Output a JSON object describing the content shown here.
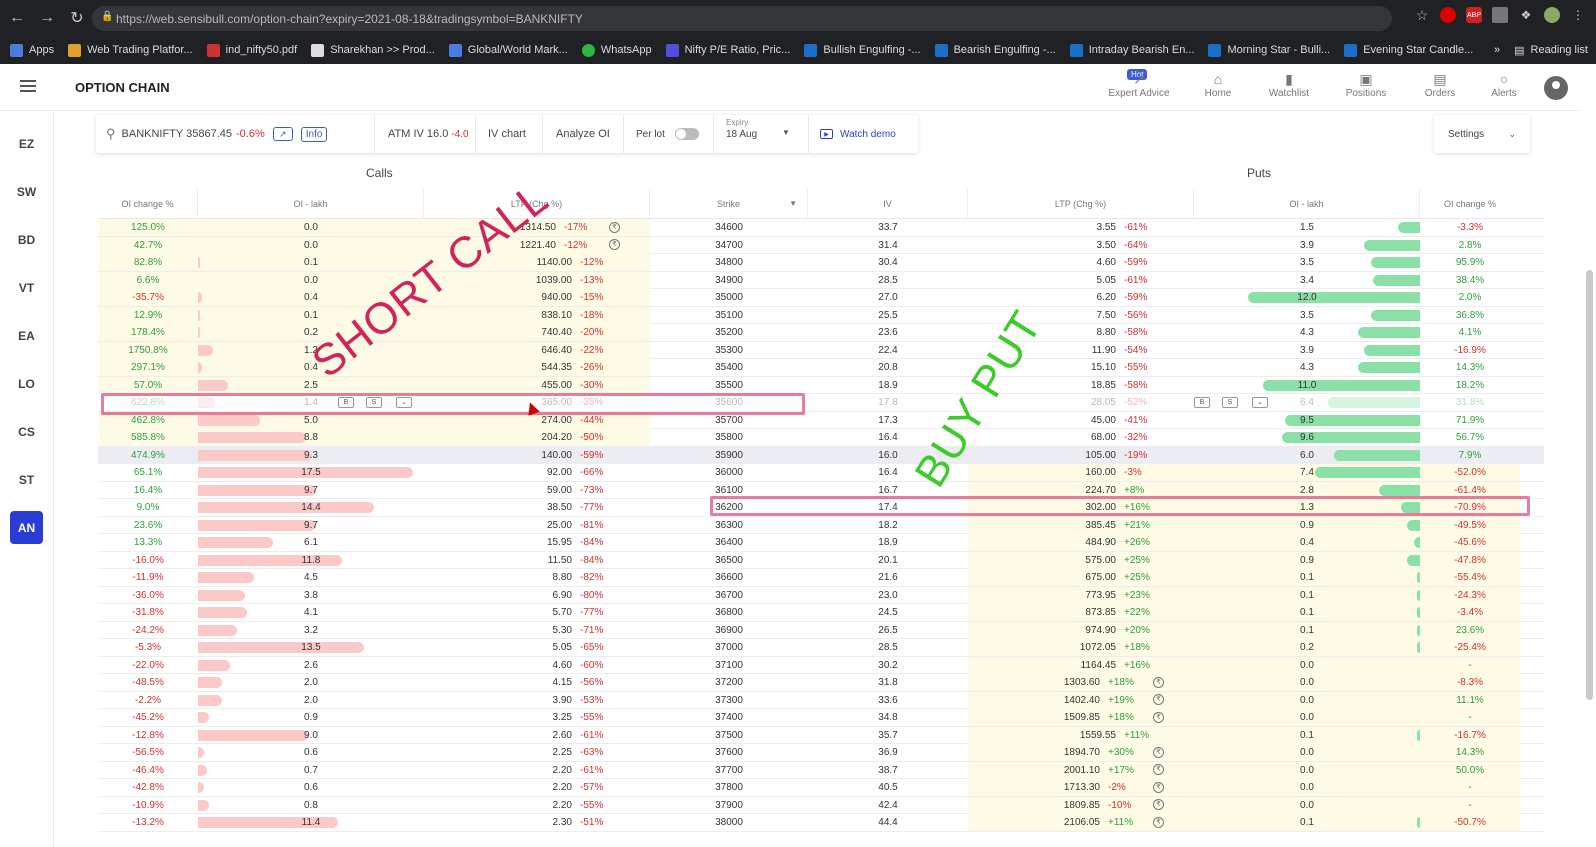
{
  "browser": {
    "url": "https://web.sensibull.com/option-chain?expiry=2021-08-18&tradingsymbol=BANKNIFTY",
    "bookmarks": [
      "Apps",
      "Web Trading Platfor...",
      "ind_nifty50.pdf",
      "Sharekhan >> Prod...",
      "Global/World Mark...",
      "WhatsApp",
      "Nifty P/E Ratio, Pric...",
      "Bullish Engulfing -...",
      "Bearish Engulfing -...",
      "Intraday Bearish En...",
      "Morning Star - Bulli...",
      "Evening Star Candle..."
    ],
    "reading_list": "Reading list",
    "ext_labels": [
      "ABP"
    ]
  },
  "header": {
    "title": "OPTION CHAIN",
    "hot_badge": "Hot",
    "nav": [
      "Expert Advice",
      "Home",
      "Watchlist",
      "Positions",
      "Orders",
      "Alerts"
    ]
  },
  "sidebar": [
    "EZ",
    "SW",
    "BD",
    "VT",
    "EA",
    "LO",
    "CS",
    "ST",
    "AN"
  ],
  "toolbar": {
    "symbol": "BANKNIFTY 35867.45",
    "symbol_change": "-0.6%",
    "info": "Info",
    "atm_iv": "ATM IV 16.0",
    "atm_iv_change": "-4.0",
    "iv_chart": "IV chart",
    "analyze_oi": "Analyze OI",
    "per_lot": "Per lot",
    "expiry_label": "Expiry",
    "expiry_value": "18 Aug",
    "watch_demo": "Watch demo",
    "settings": "Settings"
  },
  "sections": {
    "calls": "Calls",
    "puts": "Puts"
  },
  "columns": [
    "OI change %",
    "OI - lakh",
    "LTP (Chg %)",
    "Strike",
    "IV",
    "LTP (Chg %)",
    "OI - lakh",
    "OI change %"
  ],
  "row_buttons": {
    "buy": "B",
    "sell": "S"
  },
  "annotations": {
    "short_call": "SHORT CALL",
    "buy_put": "BUY PUT"
  },
  "colors": {
    "positive": "#2e9e3d",
    "negative": "#d32f2f",
    "accent": "#2a3cd6",
    "highlight": "#e0507a"
  },
  "rows": [
    {
      "coc": "125.0%",
      "coi": "0.0",
      "cl": "1314.50",
      "clc": "-17%",
      "strike": "34600",
      "iv": "33.7",
      "pl": "3.55",
      "plc": "-61%",
      "poi": "1.5",
      "poc": "-3.3%",
      "cbar": 0,
      "pbar": 0.1,
      "cc": 1,
      "pc": 0
    },
    {
      "coc": "42.7%",
      "coi": "0.0",
      "cl": "1221.40",
      "clc": "-12%",
      "strike": "34700",
      "iv": "31.4",
      "pl": "3.50",
      "plc": "-64%",
      "poi": "3.9",
      "poc": "2.8%",
      "cbar": 0,
      "pbar": 0.26,
      "cc": 1,
      "pc": 0
    },
    {
      "coc": "82.8%",
      "coi": "0.1",
      "cl": "1140.00",
      "clc": "-12%",
      "strike": "34800",
      "iv": "30.4",
      "pl": "4.60",
      "plc": "-59%",
      "poi": "3.5",
      "poc": "95.9%",
      "cbar": 0.01,
      "pbar": 0.23,
      "cc": 0,
      "pc": 0
    },
    {
      "coc": "6.6%",
      "coi": "0.0",
      "cl": "1039.00",
      "clc": "-13%",
      "strike": "34900",
      "iv": "28.5",
      "pl": "5.05",
      "plc": "-61%",
      "poi": "3.4",
      "poc": "38.4%",
      "cbar": 0,
      "pbar": 0.22,
      "cc": 0,
      "pc": 0
    },
    {
      "coc": "-35.7%",
      "coi": "0.4",
      "cl": "940.00",
      "clc": "-15%",
      "strike": "35000",
      "iv": "27.0",
      "pl": "6.20",
      "plc": "-59%",
      "poi": "12.0",
      "poc": "2.0%",
      "cbar": 0.02,
      "pbar": 0.8,
      "cc": 0,
      "pc": 0
    },
    {
      "coc": "12.9%",
      "coi": "0.1",
      "cl": "838.10",
      "clc": "-18%",
      "strike": "35100",
      "iv": "25.5",
      "pl": "7.50",
      "plc": "-56%",
      "poi": "3.5",
      "poc": "36.8%",
      "cbar": 0.01,
      "pbar": 0.23,
      "cc": 0,
      "pc": 0
    },
    {
      "coc": "178.4%",
      "coi": "0.2",
      "cl": "740.40",
      "clc": "-20%",
      "strike": "35200",
      "iv": "23.6",
      "pl": "8.80",
      "plc": "-58%",
      "poi": "4.3",
      "poc": "4.1%",
      "cbar": 0.01,
      "pbar": 0.29,
      "cc": 0,
      "pc": 0
    },
    {
      "coc": "1750.8%",
      "coi": "1.2",
      "cl": "646.40",
      "clc": "-22%",
      "strike": "35300",
      "iv": "22.4",
      "pl": "11.90",
      "plc": "-54%",
      "poi": "3.9",
      "poc": "-16.9%",
      "cbar": 0.07,
      "pbar": 0.26,
      "cc": 0,
      "pc": 0
    },
    {
      "coc": "297.1%",
      "coi": "0.4",
      "cl": "544.35",
      "clc": "-26%",
      "strike": "35400",
      "iv": "20.8",
      "pl": "15.10",
      "plc": "-55%",
      "poi": "4.3",
      "poc": "14.3%",
      "cbar": 0.02,
      "pbar": 0.29,
      "cc": 0,
      "pc": 0
    },
    {
      "coc": "57.0%",
      "coi": "2.5",
      "cl": "455.00",
      "clc": "-30%",
      "strike": "35500",
      "iv": "18.9",
      "pl": "18.85",
      "plc": "-58%",
      "poi": "11.0",
      "poc": "18.2%",
      "cbar": 0.14,
      "pbar": 0.73,
      "cc": 0,
      "pc": 0
    },
    {
      "coc": "622.8%",
      "coi": "1.4",
      "cl": "365.00",
      "clc": "-35%",
      "strike": "35600",
      "iv": "17.8",
      "pl": "28.05",
      "plc": "-52%",
      "poi": "6.4",
      "poc": "31.8%",
      "cbar": 0.08,
      "pbar": 0.43,
      "cc": 0,
      "pc": 0,
      "faded": 1
    },
    {
      "coc": "462.8%",
      "coi": "5.0",
      "cl": "274.00",
      "clc": "-44%",
      "strike": "35700",
      "iv": "17.3",
      "pl": "45.00",
      "plc": "-41%",
      "poi": "9.5",
      "poc": "71.9%",
      "cbar": 0.29,
      "pbar": 0.63,
      "cc": 0,
      "pc": 0
    },
    {
      "coc": "585.8%",
      "coi": "8.8",
      "cl": "204.20",
      "clc": "-50%",
      "strike": "35800",
      "iv": "16.4",
      "pl": "68.00",
      "plc": "-32%",
      "poi": "9.6",
      "poc": "56.7%",
      "cbar": 0.5,
      "pbar": 0.64,
      "cc": 0,
      "pc": 0
    },
    {
      "coc": "474.9%",
      "coi": "9.3",
      "cl": "140.00",
      "clc": "-59%",
      "strike": "35900",
      "iv": "16.0",
      "pl": "105.00",
      "plc": "-19%",
      "poi": "6.0",
      "poc": "7.9%",
      "cbar": 0.53,
      "pbar": 0.4,
      "cc": 0,
      "pc": 0,
      "atm": 1
    },
    {
      "coc": "65.1%",
      "coi": "17.5",
      "cl": "92.00",
      "clc": "-66%",
      "strike": "36000",
      "iv": "16.4",
      "pl": "160.00",
      "plc": "-3%",
      "poi": "7.4",
      "poc": "-52.0%",
      "cbar": 1.0,
      "pbar": 0.49,
      "cc": 0,
      "pc": 0
    },
    {
      "coc": "16.4%",
      "coi": "9.7",
      "cl": "59.00",
      "clc": "-73%",
      "strike": "36100",
      "iv": "16.7",
      "pl": "224.70",
      "plc": "+8%",
      "poi": "2.8",
      "poc": "-61.4%",
      "cbar": 0.55,
      "pbar": 0.19,
      "cc": 0,
      "pc": 0
    },
    {
      "coc": "9.0%",
      "coi": "14.4",
      "cl": "38.50",
      "clc": "-77%",
      "strike": "36200",
      "iv": "17.4",
      "pl": "302.00",
      "plc": "+16%",
      "poi": "1.3",
      "poc": "-70.9%",
      "cbar": 0.82,
      "pbar": 0.09,
      "cc": 0,
      "pc": 0
    },
    {
      "coc": "23.6%",
      "coi": "9.7",
      "cl": "25.00",
      "clc": "-81%",
      "strike": "36300",
      "iv": "18.2",
      "pl": "385.45",
      "plc": "+21%",
      "poi": "0.9",
      "poc": "-49.5%",
      "cbar": 0.55,
      "pbar": 0.06,
      "cc": 0,
      "pc": 0
    },
    {
      "coc": "13.3%",
      "coi": "6.1",
      "cl": "15.95",
      "clc": "-84%",
      "strike": "36400",
      "iv": "18.9",
      "pl": "484.90",
      "plc": "+26%",
      "poi": "0.4",
      "poc": "-45.6%",
      "cbar": 0.35,
      "pbar": 0.03,
      "cc": 0,
      "pc": 0
    },
    {
      "coc": "-16.0%",
      "coi": "11.8",
      "cl": "11.50",
      "clc": "-84%",
      "strike": "36500",
      "iv": "20.1",
      "pl": "575.00",
      "plc": "+25%",
      "poi": "0.9",
      "poc": "-47.8%",
      "cbar": 0.67,
      "pbar": 0.06,
      "cc": 0,
      "pc": 0
    },
    {
      "coc": "-11.9%",
      "coi": "4.5",
      "cl": "8.80",
      "clc": "-82%",
      "strike": "36600",
      "iv": "21.6",
      "pl": "675.00",
      "plc": "+25%",
      "poi": "0.1",
      "poc": "-55.4%",
      "cbar": 0.26,
      "pbar": 0.01,
      "cc": 0,
      "pc": 0
    },
    {
      "coc": "-36.0%",
      "coi": "3.8",
      "cl": "6.90",
      "clc": "-80%",
      "strike": "36700",
      "iv": "23.0",
      "pl": "773.95",
      "plc": "+23%",
      "poi": "0.1",
      "poc": "-24.3%",
      "cbar": 0.22,
      "pbar": 0.01,
      "cc": 0,
      "pc": 0
    },
    {
      "coc": "-31.8%",
      "coi": "4.1",
      "cl": "5.70",
      "clc": "-77%",
      "strike": "36800",
      "iv": "24.5",
      "pl": "873.85",
      "plc": "+22%",
      "poi": "0.1",
      "poc": "-3.4%",
      "cbar": 0.23,
      "pbar": 0.01,
      "cc": 0,
      "pc": 0
    },
    {
      "coc": "-24.2%",
      "coi": "3.2",
      "cl": "5.30",
      "clc": "-71%",
      "strike": "36900",
      "iv": "26.5",
      "pl": "974.90",
      "plc": "+20%",
      "poi": "0.1",
      "poc": "23.6%",
      "cbar": 0.18,
      "pbar": 0.01,
      "cc": 0,
      "pc": 0
    },
    {
      "coc": "-5.3%",
      "coi": "13.5",
      "cl": "5.05",
      "clc": "-65%",
      "strike": "37000",
      "iv": "28.5",
      "pl": "1072.05",
      "plc": "+18%",
      "poi": "0.2",
      "poc": "-25.4%",
      "cbar": 0.77,
      "pbar": 0.01,
      "cc": 0,
      "pc": 0
    },
    {
      "coc": "-22.0%",
      "coi": "2.6",
      "cl": "4.60",
      "clc": "-60%",
      "strike": "37100",
      "iv": "30.2",
      "pl": "1164.45",
      "plc": "+16%",
      "poi": "0.0",
      "poc": "-",
      "cbar": 0.15,
      "pbar": 0,
      "cc": 0,
      "pc": 0
    },
    {
      "coc": "-48.5%",
      "coi": "2.0",
      "cl": "4.15",
      "clc": "-56%",
      "strike": "37200",
      "iv": "31.8",
      "pl": "1303.60",
      "plc": "+18%",
      "poi": "0.0",
      "poc": "-8.3%",
      "cbar": 0.11,
      "pbar": 0,
      "cc": 0,
      "pc": 1
    },
    {
      "coc": "-2.2%",
      "coi": "2.0",
      "cl": "3.90",
      "clc": "-53%",
      "strike": "37300",
      "iv": "33.6",
      "pl": "1402.40",
      "plc": "+19%",
      "poi": "0.0",
      "poc": "11.1%",
      "cbar": 0.11,
      "pbar": 0,
      "cc": 0,
      "pc": 1
    },
    {
      "coc": "-45.2%",
      "coi": "0.9",
      "cl": "3.25",
      "clc": "-55%",
      "strike": "37400",
      "iv": "34.8",
      "pl": "1509.85",
      "plc": "+18%",
      "poi": "0.0",
      "poc": "-",
      "cbar": 0.05,
      "pbar": 0,
      "cc": 0,
      "pc": 1
    },
    {
      "coc": "-12.8%",
      "coi": "9.0",
      "cl": "2.60",
      "clc": "-61%",
      "strike": "37500",
      "iv": "35.7",
      "pl": "1559.55",
      "plc": "+11%",
      "poi": "0.1",
      "poc": "-16.7%",
      "cbar": 0.51,
      "pbar": 0.01,
      "cc": 0,
      "pc": 0
    },
    {
      "coc": "-56.5%",
      "coi": "0.6",
      "cl": "2.25",
      "clc": "-63%",
      "strike": "37600",
      "iv": "36.9",
      "pl": "1894.70",
      "plc": "+30%",
      "poi": "0.0",
      "poc": "14.3%",
      "cbar": 0.03,
      "pbar": 0,
      "cc": 0,
      "pc": 1
    },
    {
      "coc": "-46.4%",
      "coi": "0.7",
      "cl": "2.20",
      "clc": "-61%",
      "strike": "37700",
      "iv": "38.7",
      "pl": "2001.10",
      "plc": "+17%",
      "poi": "0.0",
      "poc": "50.0%",
      "cbar": 0.04,
      "pbar": 0,
      "cc": 0,
      "pc": 1
    },
    {
      "coc": "-42.8%",
      "coi": "0.6",
      "cl": "2.20",
      "clc": "-57%",
      "strike": "37800",
      "iv": "40.5",
      "pl": "1713.30",
      "plc": "-2%",
      "poi": "0.0",
      "poc": "-",
      "cbar": 0.03,
      "pbar": 0,
      "cc": 0,
      "pc": 1
    },
    {
      "coc": "-10.9%",
      "coi": "0.8",
      "cl": "2.20",
      "clc": "-55%",
      "strike": "37900",
      "iv": "42.4",
      "pl": "1809.85",
      "plc": "-10%",
      "poi": "0.0",
      "poc": "-",
      "cbar": 0.05,
      "pbar": 0,
      "cc": 0,
      "pc": 1
    },
    {
      "coc": "-13.2%",
      "coi": "11.4",
      "cl": "2.30",
      "clc": "-51%",
      "strike": "38000",
      "iv": "44.4",
      "pl": "2106.05",
      "plc": "+11%",
      "poi": "0.1",
      "poc": "-50.7%",
      "cbar": 0.65,
      "pbar": 0.01,
      "cc": 0,
      "pc": 1
    }
  ]
}
